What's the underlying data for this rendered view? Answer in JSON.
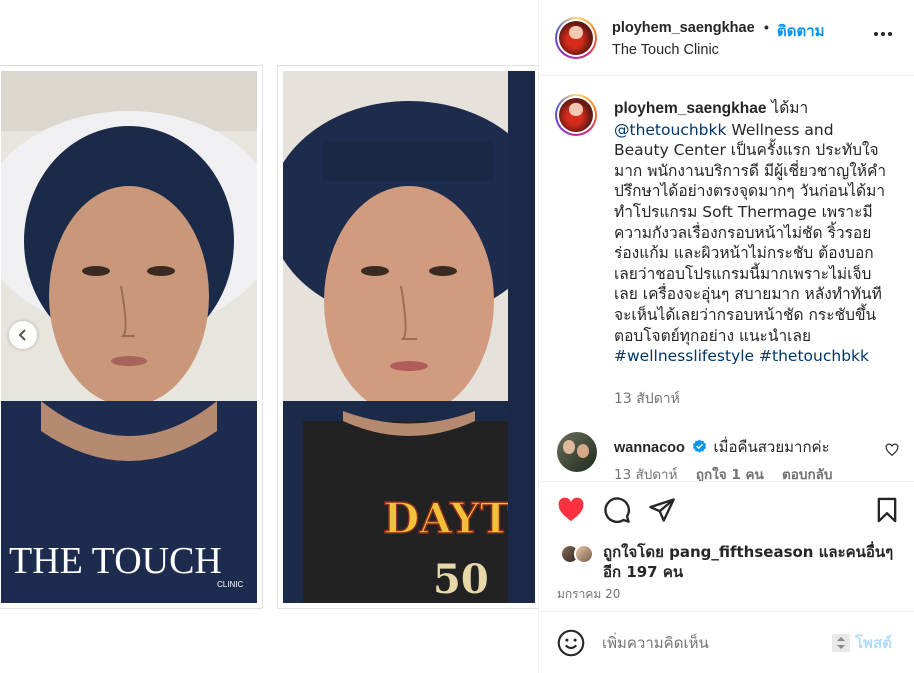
{
  "post": {
    "author": "ployhem_saengkhae",
    "dot": "•",
    "follow_label": "ติดตาม",
    "location": "The Touch Clinic",
    "photo_1_overlay_text": "THE TOUCH",
    "photo_1_overlay_subtext": "CLINIC",
    "photo_2_shirt_text": "DAYTO",
    "photo_2_shirt_number": "50"
  },
  "caption": {
    "username": "ployhem_saengkhae",
    "verb": "ได้มา",
    "mention": "@thetouchbkk",
    "text": "Wellness and Beauty Center เป็นครั้งแรก ประทับใจมาก พนักงานบริการดี มีผู้เชี่ยวชาญให้คำปรึกษาได้อย่างตรงจุดมากๆ วันก่อนได้มาทำโปรแกรม Soft Thermage เพราะมีความกังวลเรื่องกรอบหน้าไม่ชัด ริ้วรอยร่องแก้ม และผิวหน้าไม่กระชับ ต้องบอกเลยว่าชอบโปรแกรมนี้มากเพราะไม่เจ็บเลย เครื่องจะอุ่นๆ สบายมาก หลังทำทันทีจะเห็นได้เลยว่ากรอบหน้าชัด กระชับขึ้น ตอบโจตย์ทุกอย่าง แนะนำเลย",
    "hashtag_1": "#wellnesslifestyle",
    "hashtag_2": "#thetouchbkk",
    "time": "13 สัปดาห์"
  },
  "comment": {
    "username": "wannacoo",
    "text": "เมื่อคืนสวยมากค่ะ",
    "time": "13 สัปดาห์",
    "likes": "ถูกใจ 1 คน",
    "reply": "ตอบกลับ"
  },
  "likes": {
    "text": "ถูกใจโดย pang_fifthseason และคนอื่นๆ อีก 197 คน"
  },
  "post_date": "มกราคม 20",
  "add_comment": {
    "placeholder": "เพิ่มความคิดเห็น",
    "post_label": "โพสต์"
  },
  "colors": {
    "accent": "#0095f6",
    "link": "#00376b",
    "like_red": "#ff3040",
    "muted": "#737373",
    "post_disabled": "#b3dbff"
  },
  "icons": [
    "chevron-left-icon",
    "more-icon",
    "heart-icon",
    "comment-icon",
    "share-icon",
    "bookmark-icon",
    "verified-icon",
    "emoji-icon",
    "grammar-icon"
  ]
}
